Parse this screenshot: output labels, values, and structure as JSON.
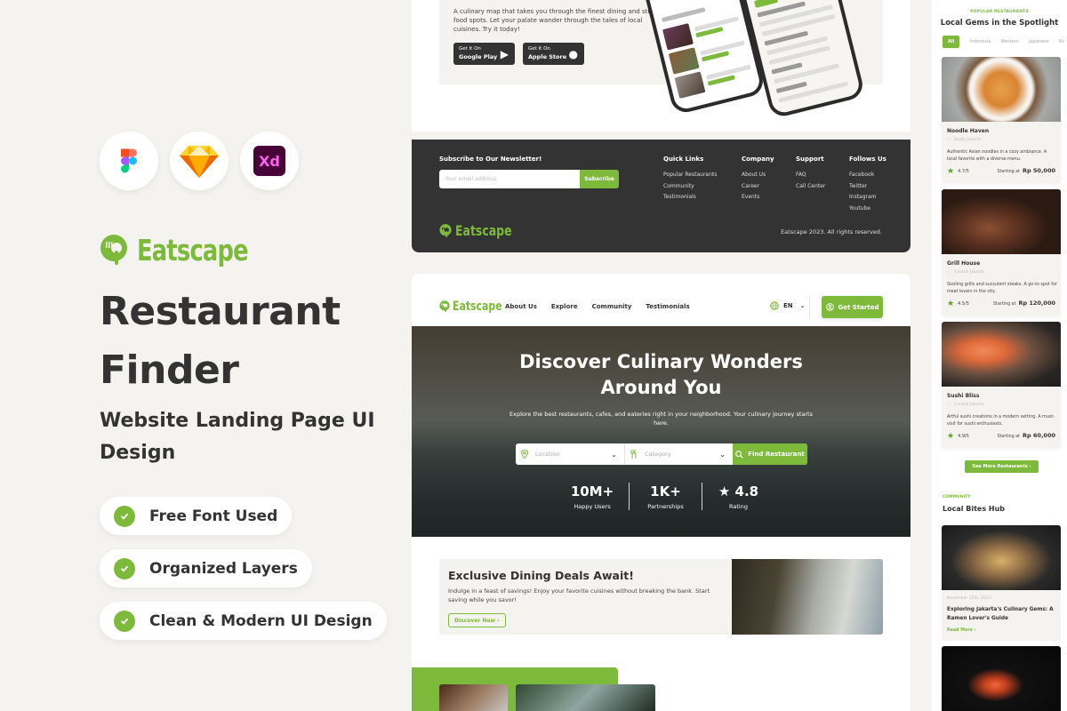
{
  "left": {
    "tools": [
      "figma",
      "sketch",
      "adobe-xd"
    ],
    "xd_label": "Xd",
    "brand": "Eatscape",
    "title_line1": "Restaurant",
    "title_line2": "Finder",
    "subtitle": "Website Landing Page UI Design",
    "features": [
      "Free Font Used",
      "Organized Layers",
      "Clean & Modern UI Design"
    ]
  },
  "app_section": {
    "description": "A culinary map that takes you through the finest dining and street food spots. Let your palate wander through the tales of local cuisines. Try it today!",
    "stores": [
      {
        "line1": "Get It On",
        "line2": "Google Play",
        "icon": "play-icon"
      },
      {
        "line1": "Get It On",
        "line2": "Apple Store",
        "icon": "apple-icon"
      }
    ]
  },
  "footer": {
    "newsletter_title": "Subscribe to Our Newsletter!",
    "email_placeholder": "Your email address",
    "subscribe_label": "Subscribe",
    "columns": [
      {
        "title": "Quick Links",
        "links": [
          "Popular Restaurants",
          "Community",
          "Testimonials"
        ]
      },
      {
        "title": "Company",
        "links": [
          "About Us",
          "Career",
          "Events"
        ]
      },
      {
        "title": "Support",
        "links": [
          "FAQ",
          "Call Center"
        ]
      },
      {
        "title": "Follows Us",
        "links": [
          "Facebook",
          "Twitter",
          "Instagram",
          "Youtube"
        ]
      }
    ],
    "brand": "Eatscape",
    "copyright": "Eatscape 2023. All rights reserved."
  },
  "landing": {
    "brand": "Eatscape",
    "nav": [
      "About Us",
      "Explore",
      "Community",
      "Testimonials"
    ],
    "lang": "EN",
    "get_started": "Get Started",
    "hero_title_1": "Discover Culinary Wonders",
    "hero_title_2": "Around You",
    "hero_text": "Explore the best restaurants, cafes, and eateries right in your neighborhood. Your culinary journey starts here.",
    "location_placeholder": "Location",
    "category_placeholder": "Category",
    "find_label": "Find Restaurant",
    "stats": [
      {
        "value": "10M+",
        "label": "Happy Users"
      },
      {
        "value": "1K+",
        "label": "Partnerships"
      },
      {
        "value": "★ 4.8",
        "label": "Rating"
      }
    ],
    "deal_title": "Exclusive Dining Deals Await!",
    "deal_text": "Indulge in a feast of savings! Enjoy your favorite cuisines without breaking the bank. Start saving while you savor!",
    "deal_button": "Discover Now ›"
  },
  "mobile": {
    "popular_tag": "POPULAR RESTAURANTS",
    "popular_title": "Local Gems in the Spotlight",
    "chips": [
      "All",
      "Indonesia",
      "Western",
      "Japanese",
      "Ko"
    ],
    "restaurants": [
      {
        "name": "Noodle Haven",
        "location": "South Jakarta",
        "desc": "Authentic Asian noodles in a cozy ambiance. A local favorite with a diverse menu.",
        "rating": "4.7/5",
        "starting": "Starting at",
        "price": "Rp 50,000"
      },
      {
        "name": "Grill House",
        "location": "Central Jakarta",
        "desc": "Sizzling grills and succulent steaks. A go-to spot for meat lovers in the city.",
        "rating": "4.5/5",
        "starting": "Starting at",
        "price": "Rp 120,000"
      },
      {
        "name": "Sushi Bliss",
        "location": "Central Jakarta",
        "desc": "Artful sushi creations in a modern setting. A must-visit for sushi enthusiasts.",
        "rating": "4.9/5",
        "starting": "Starting at",
        "price": "Rp 60,000"
      }
    ],
    "see_more": "See More Restaurants ›",
    "community_tag": "COMMUNITY",
    "community_title": "Local Bites Hub",
    "blog": {
      "date": "November 25th, 2023",
      "title": "Exploring Jakarta's Culinary Gems: A Ramen Lover's Guide",
      "read_more": "Read More ›"
    }
  },
  "colors": {
    "accent": "#7dba3b",
    "dark": "#333333",
    "background": "#f4f3f0"
  }
}
